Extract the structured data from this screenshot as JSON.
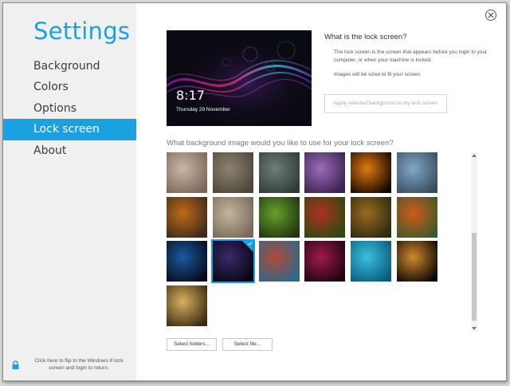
{
  "sidebar": {
    "title": "Settings",
    "items": [
      {
        "label": "Background"
      },
      {
        "label": "Colors"
      },
      {
        "label": "Options"
      },
      {
        "label": "Lock screen"
      },
      {
        "label": "About"
      }
    ],
    "footer_text": "Click here to flip to the Windows 8 lock screen and login to return."
  },
  "preview": {
    "time": "8:17",
    "date": "Thursday 29 November"
  },
  "info": {
    "title": "What is the lock screen?",
    "description": "The lock screen is the screen that appears before you login to your computer, or when your machine is locked.",
    "note": "Images will be sized to fit your screen.",
    "apply_label": "Apply selected background to my lock screen"
  },
  "gallery": {
    "question": "What background image would you like to use for your lock screen?",
    "selected_index": 13,
    "thumbnails": [
      {
        "name": "warm-light",
        "c1": "#c9b7a7",
        "c2": "#7a6658"
      },
      {
        "name": "lizard-texture",
        "c1": "#8d8371",
        "c2": "#4c4538"
      },
      {
        "name": "shell-closeup",
        "c1": "#6e7e7a",
        "c2": "#2e3935"
      },
      {
        "name": "purple-petal",
        "c1": "#9b6bb8",
        "c2": "#3a2150"
      },
      {
        "name": "fire-glow",
        "c1": "#e07a10",
        "c2": "#120600"
      },
      {
        "name": "blue-bokeh",
        "c1": "#7fa8c9",
        "c2": "#3a4b5c"
      },
      {
        "name": "rusty-metal",
        "c1": "#c06a1a",
        "c2": "#3a2a1a"
      },
      {
        "name": "sand-rock",
        "c1": "#c4b49e",
        "c2": "#776957"
      },
      {
        "name": "green-leaves",
        "c1": "#6a9e2a",
        "c2": "#1d3510"
      },
      {
        "name": "red-leaf",
        "c1": "#b03020",
        "c2": "#2a4a10"
      },
      {
        "name": "autumn-bokeh",
        "c1": "#9a6a20",
        "c2": "#2a2a10"
      },
      {
        "name": "orange-flower",
        "c1": "#d05a1a",
        "c2": "#3a5a2a"
      },
      {
        "name": "blue-light-streak",
        "c1": "#1a5aa0",
        "c2": "#050a18"
      },
      {
        "name": "wave-dark",
        "c1": "#3a2a6a",
        "c2": "#05050f"
      },
      {
        "name": "chameleon",
        "c1": "#b04a3a",
        "c2": "#2a6a8a"
      },
      {
        "name": "crimson-abstract",
        "c1": "#a01a4a",
        "c2": "#1a0510"
      },
      {
        "name": "teal-waves",
        "c1": "#3ac0e0",
        "c2": "#0a5a7a"
      },
      {
        "name": "orange-glow",
        "c1": "#d08a2a",
        "c2": "#0a0505"
      },
      {
        "name": "golden-tree",
        "c1": "#d8b060",
        "c2": "#3a2a10"
      }
    ]
  },
  "buttons": {
    "select_folders": "Select folders...",
    "select_file": "Select file..."
  },
  "colors": {
    "accent": "#1ba1e2"
  }
}
